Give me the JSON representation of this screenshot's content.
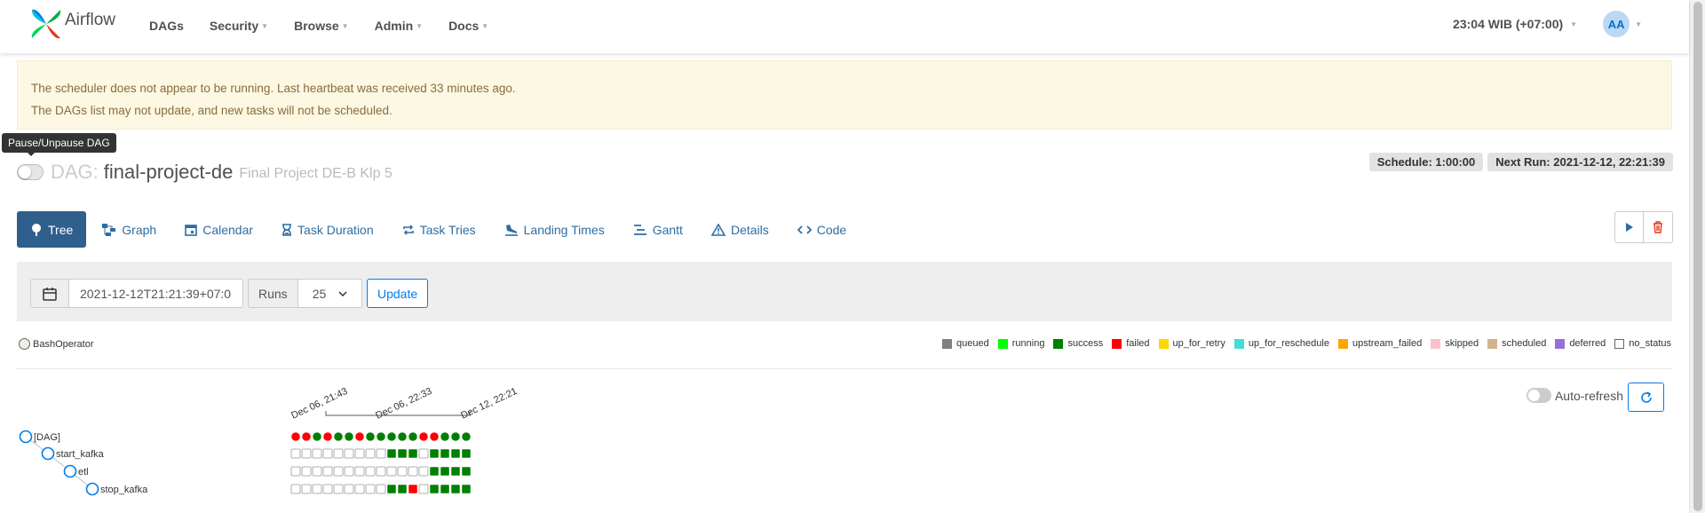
{
  "navbar": {
    "brand": "Airflow",
    "items": [
      "DAGs",
      "Security",
      "Browse",
      "Admin",
      "Docs"
    ],
    "clock": "23:04 WIB (+07:00)",
    "user_initials": "AA"
  },
  "alert": {
    "line1": "The scheduler does not appear to be running. Last heartbeat was received 33 minutes ago.",
    "line2": "The DAGs list may not update, and new tasks will not be scheduled."
  },
  "tooltip": "Pause/Unpause DAG",
  "dag": {
    "prefix": "DAG:",
    "id": "final-project-de",
    "description": "Final Project DE-B Klp 5",
    "schedule": "Schedule: 1:00:00",
    "next_run": "Next Run: 2021-12-12, 22:21:39",
    "paused": true
  },
  "tabs": [
    "Tree",
    "Graph",
    "Calendar",
    "Task Duration",
    "Task Tries",
    "Landing Times",
    "Gantt",
    "Details",
    "Code"
  ],
  "filter": {
    "base_date": "2021-12-12T21:21:39+07:0",
    "runs_label": "Runs",
    "runs_value": "25",
    "update_label": "Update"
  },
  "legend": {
    "operator": "BashOperator",
    "operator_color": "#f0ede4",
    "states": [
      {
        "name": "queued",
        "color": "#808080"
      },
      {
        "name": "running",
        "color": "#00ff00"
      },
      {
        "name": "success",
        "color": "#008000"
      },
      {
        "name": "failed",
        "color": "#ff0000"
      },
      {
        "name": "up_for_retry",
        "color": "#ffd700"
      },
      {
        "name": "up_for_reschedule",
        "color": "#40e0d0"
      },
      {
        "name": "upstream_failed",
        "color": "#ffa500"
      },
      {
        "name": "skipped",
        "color": "#ffc0cb"
      },
      {
        "name": "scheduled",
        "color": "#d2b48c"
      },
      {
        "name": "deferred",
        "color": "#9370db"
      },
      {
        "name": "no_status",
        "color": "#ffffff"
      }
    ]
  },
  "autorefresh_label": "Auto-refresh",
  "tree": {
    "date_labels": [
      "Dec 06, 21:43",
      "Dec 06, 22:33",
      "Dec 12, 22:21"
    ],
    "nodes": [
      "[DAG]",
      "start_kafka",
      "etl",
      "stop_kafka"
    ],
    "dag_runs": [
      "failed",
      "failed",
      "success",
      "failed",
      "success",
      "success",
      "failed",
      "success",
      "success",
      "success",
      "success",
      "success",
      "failed",
      "failed",
      "success",
      "success",
      "success"
    ],
    "tasks": [
      [
        "none",
        "none",
        "none",
        "none",
        "none",
        "none",
        "none",
        "none",
        "none",
        "success",
        "success",
        "success",
        "none",
        "success",
        "success",
        "success",
        "success"
      ],
      [
        "none",
        "none",
        "none",
        "none",
        "none",
        "none",
        "none",
        "none",
        "none",
        "none",
        "none",
        "none",
        "none",
        "success",
        "success",
        "success",
        "success"
      ],
      [
        "none",
        "none",
        "none",
        "none",
        "none",
        "none",
        "none",
        "none",
        "none",
        "success",
        "success",
        "failed",
        "none",
        "success",
        "success",
        "success",
        "success"
      ]
    ]
  }
}
